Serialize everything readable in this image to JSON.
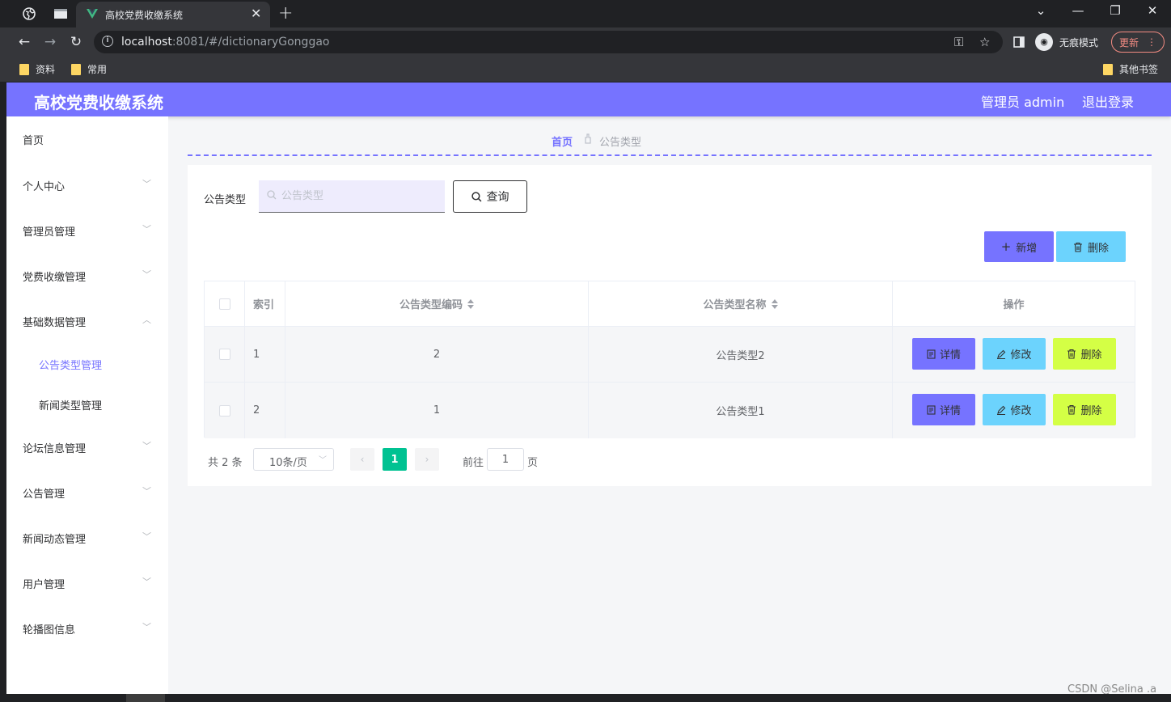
{
  "browser": {
    "tab_title": "高校党费收缴系统",
    "url_host": "localhost",
    "url_rest": ":8081/#/dictionaryGonggao",
    "incognito_label": "无痕模式",
    "update_label": "更新",
    "bookmarks": [
      "资料",
      "常用"
    ],
    "other_bookmarks": "其他书签"
  },
  "header": {
    "title": "高校党费收缴系统",
    "user": "管理员 admin",
    "logout": "退出登录"
  },
  "sidebar": {
    "items": [
      {
        "label": "首页"
      },
      {
        "label": "个人中心"
      },
      {
        "label": "管理员管理"
      },
      {
        "label": "党费收缴管理"
      },
      {
        "label": "基础数据管理"
      },
      {
        "label": "论坛信息管理"
      },
      {
        "label": "公告管理"
      },
      {
        "label": "新闻动态管理"
      },
      {
        "label": "用户管理"
      },
      {
        "label": "轮播图信息"
      }
    ],
    "subitems": [
      {
        "label": "公告类型管理",
        "active": true
      },
      {
        "label": "新闻类型管理",
        "active": false
      }
    ]
  },
  "breadcrumb": {
    "home": "首页",
    "current": "公告类型"
  },
  "search": {
    "label": "公告类型",
    "placeholder": "公告类型",
    "button": "查询"
  },
  "actions": {
    "add": "新增",
    "delete": "删除"
  },
  "table": {
    "columns": [
      "索引",
      "公告类型编码",
      "公告类型名称",
      "操作"
    ],
    "rows": [
      {
        "index": "1",
        "code": "2",
        "name": "公告类型2"
      },
      {
        "index": "2",
        "code": "1",
        "name": "公告类型1"
      }
    ],
    "row_actions": {
      "detail": "详情",
      "edit": "修改",
      "delete": "删除"
    }
  },
  "pagination": {
    "total": "共 2 条",
    "page_size": "10条/页",
    "current_page": "1",
    "goto_label": "前往",
    "goto_value": "1",
    "page_unit": "页"
  },
  "watermark": "CSDN @Selina .a",
  "colors": {
    "header": "#7673ff",
    "primary": "#7673ff",
    "info": "#6cd3fd",
    "warn": "#d4ff45",
    "pager_active": "#00c292"
  }
}
